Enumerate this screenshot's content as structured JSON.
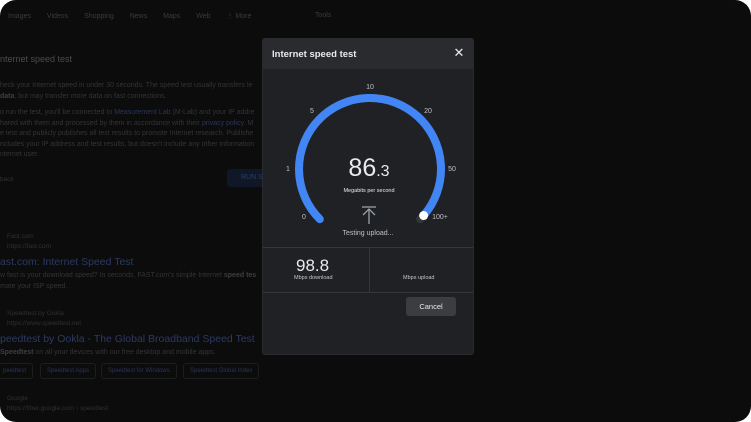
{
  "background": {
    "nav": [
      "Images",
      "Videos",
      "Shopping",
      "News",
      "Maps",
      "Web",
      "⋮ More"
    ],
    "tools": "Tools",
    "heading": "nternet speed test",
    "para1": {
      "t1": "heck your Internet speed in under 30 seconds. The speed test usually transfers le",
      "bold": "data",
      "t2": ", but may transfer more data on fast connections."
    },
    "para2": {
      "t1": "o run the test, you'll be connected to ",
      "link1": "Measurement Lab",
      "t2": " (M-Lab) and your IP addre",
      "t3": "hared with them and processed by them in accordance with their ",
      "link2": "privacy policy",
      "t4": ". M",
      "t5": "e test and publicly publishes all test results to promote Internet research. Publishe",
      "t6": "ncludes your IP address and test results, but doesn't include any other information",
      "t7": "nternet user."
    },
    "feedback": "back",
    "run_button": "RUN S",
    "results": [
      {
        "site": "Fast.com",
        "url": "https://fast.com",
        "title": "ast.com: Internet Speed Test",
        "snippet_1": "w fast is your download speed? In seconds, FAST.com's simple Internet ",
        "snippet_bold": "speed tes",
        "snippet_2": "mate your ISP speed."
      },
      {
        "site": "Speedtest by Ookla",
        "url": "https://www.speedtest.net",
        "title": "peedtest by Ookla - The Global Broadband Speed Test",
        "snippet_bold": "Speedtest",
        "snippet_2": " on all your devices with our free desktop and mobile apps."
      },
      {
        "site": "Google",
        "url": "https://fiber.google.com › speedtest",
        "title": ""
      }
    ],
    "chips": [
      "peedtest",
      "Speedtest Apps",
      "Speedtest for Windows",
      "Speedtest Global Index"
    ]
  },
  "dialog": {
    "title": "Internet speed test",
    "close_icon": "close-icon",
    "gauge": {
      "value_int": "86",
      "value_dec": ".3",
      "unit": "Megabits per second",
      "status": "Testing upload...",
      "status_icon": "upload-arrow-icon",
      "ticks": [
        "0",
        "1",
        "5",
        "10",
        "20",
        "50",
        "100+"
      ],
      "progress_fraction": 0.985,
      "accent": "#4285f4",
      "track": "#35363a"
    },
    "download_value": "98.8",
    "download_label": "Mbps download",
    "upload_value": "",
    "upload_label": "Mbps upload",
    "cancel_label": "Cancel"
  }
}
